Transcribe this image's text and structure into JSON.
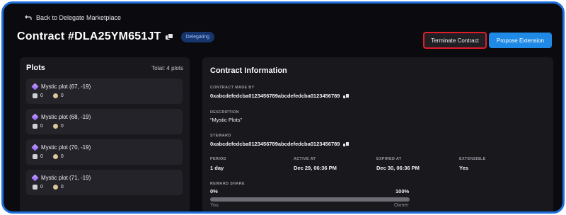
{
  "nav": {
    "back_label": "Back to Delegate Marketplace"
  },
  "header": {
    "title": "Contract #DLA25YM651JT",
    "status_badge": "Delegating",
    "terminate_label": "Terminate Contract",
    "extend_label": "Propose Extension"
  },
  "plots": {
    "heading": "Plots",
    "total": "Total: 4 plots",
    "items": [
      {
        "name": "Mystic plot (67, -19)",
        "stat_a": "0",
        "stat_b": "0"
      },
      {
        "name": "Mystic plot (68, -19)",
        "stat_a": "0",
        "stat_b": "0"
      },
      {
        "name": "Mystic plot (70, -19)",
        "stat_a": "0",
        "stat_b": "0"
      },
      {
        "name": "Mystic plot (71, -19)",
        "stat_a": "0",
        "stat_b": "0"
      }
    ]
  },
  "contract": {
    "heading": "Contract Information",
    "made_by_label": "CONTRACT MADE BY",
    "made_by": "0xabcdefedcba0123456789abcdefedcba0123456789",
    "description_label": "DESCRIPTION",
    "description": "“Mystic Plots”",
    "steward_label": "STEWARD",
    "steward": "0xabcdefedcba0123456789abcdefedcba0123456789",
    "period_label": "PERIOD",
    "period": "1 day",
    "active_label": "ACTIVE AT",
    "active": "Dec 29, 06:36 PM",
    "expired_label": "EXPIRED AT",
    "expired": "Dec 30, 06:36 PM",
    "extensible_label": "EXTENSIBLE",
    "extensible": "Yes",
    "reward_label": "REWARD SHARE",
    "reward_min": "0%",
    "reward_max": "100%",
    "reward_you": "You",
    "reward_owner": "Owner",
    "reward_you_share": 0
  },
  "colors": {
    "accent": "#1f8ae6",
    "danger_outline": "#e11d2a",
    "frame_border": "#1e6fdc",
    "badge_bg": "#16356d"
  },
  "icons": [
    "back-arrow-icon",
    "copy-icon",
    "mystic-cube-icon",
    "stat-a-icon",
    "stat-b-icon"
  ]
}
